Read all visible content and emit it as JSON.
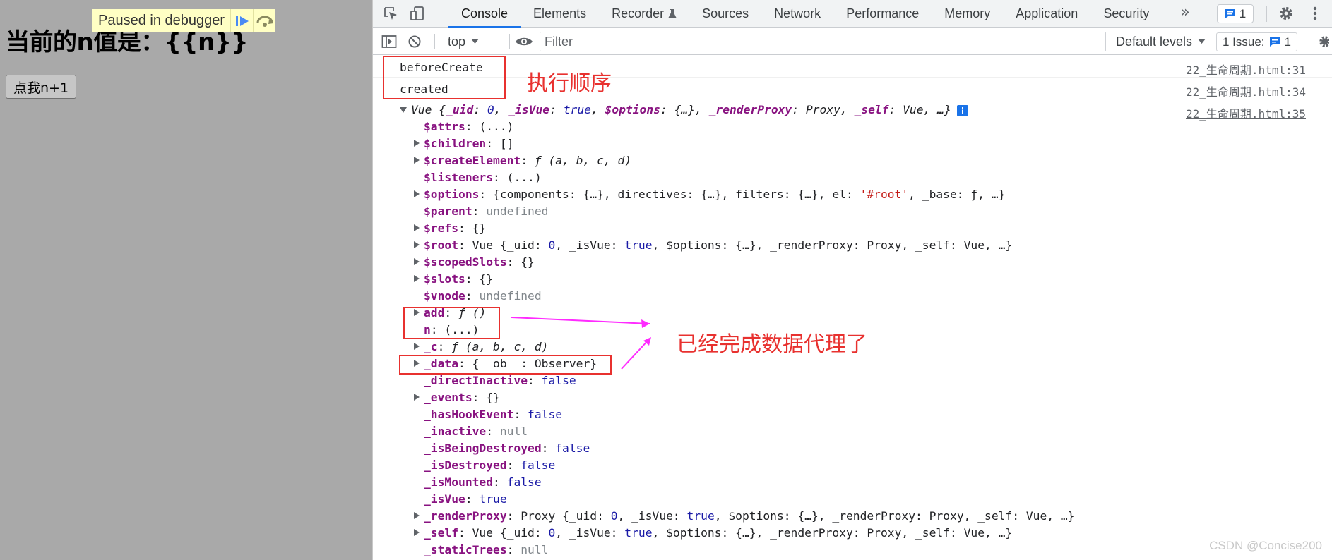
{
  "page": {
    "heading": "当前的n值是：{{n}}",
    "button_label": "点我n+1",
    "debugger_banner": "Paused in debugger",
    "colors": {
      "page_bg": "#a9a9a9",
      "banner_bg": "#ffffc4",
      "resume_icon": "#4a8af4",
      "step_icon": "#8a8a60"
    }
  },
  "devtools": {
    "tabs": [
      "Console",
      "Elements",
      "Recorder",
      "Sources",
      "Network",
      "Performance",
      "Memory",
      "Application",
      "Security"
    ],
    "active_tab": "Console",
    "more_tabs_glyph": "»",
    "messages_badge_count": "1",
    "toolbar": {
      "context": "top",
      "filter_placeholder": "Filter",
      "levels": "Default levels",
      "issues_label": "1 Issue:",
      "issues_count": "1"
    },
    "colors": {
      "accent": "#1a73e8",
      "key": "#881280",
      "keyword": "#1a1aa6",
      "string": "#c41a16",
      "muted": "#80868b"
    }
  },
  "console": {
    "messages": [
      {
        "text": "beforeCreate",
        "source": "22_生命周期.html:31"
      },
      {
        "text": "created",
        "source": "22_生命周期.html:34"
      }
    ],
    "object_source": "22_生命周期.html:35",
    "object_summary": {
      "name": "Vue",
      "parts": [
        [
          "p",
          " {"
        ],
        [
          "k",
          "_uid"
        ],
        [
          "p",
          ": "
        ],
        [
          "kw",
          "0"
        ],
        [
          "p",
          ", "
        ],
        [
          "k",
          "_isVue"
        ],
        [
          "p",
          ": "
        ],
        [
          "kw",
          "true"
        ],
        [
          "p",
          ", "
        ],
        [
          "k",
          "$options"
        ],
        [
          "p",
          ": {…}, "
        ],
        [
          "k",
          "_renderProxy"
        ],
        [
          "p",
          ": Proxy, "
        ],
        [
          "k",
          "_self"
        ],
        [
          "p",
          ": Vue, …}"
        ]
      ]
    },
    "props": [
      {
        "key": "$attrs",
        "expandable": false,
        "parts": [
          [
            "p",
            "(...)"
          ]
        ]
      },
      {
        "key": "$children",
        "expandable": true,
        "parts": [
          [
            "p",
            "[]"
          ]
        ]
      },
      {
        "key": "$createElement",
        "expandable": true,
        "parts": [
          [
            "p",
            "ƒ (a, b, c, d)"
          ]
        ],
        "italic": true
      },
      {
        "key": "$listeners",
        "expandable": false,
        "parts": [
          [
            "p",
            "(...)"
          ]
        ]
      },
      {
        "key": "$options",
        "expandable": true,
        "parts": [
          [
            "p",
            "{components: {…}, directives: {…}, filters: {…}, el: "
          ],
          [
            "str",
            "'#root'"
          ],
          [
            "p",
            ", _base: ƒ, …}"
          ]
        ]
      },
      {
        "key": "$parent",
        "expandable": false,
        "parts": [
          [
            "gr",
            "undefined"
          ]
        ]
      },
      {
        "key": "$refs",
        "expandable": true,
        "parts": [
          [
            "p",
            "{}"
          ]
        ]
      },
      {
        "key": "$root",
        "expandable": true,
        "parts": [
          [
            "p",
            "Vue {_uid: "
          ],
          [
            "kw",
            "0"
          ],
          [
            "p",
            ", _isVue: "
          ],
          [
            "kw",
            "true"
          ],
          [
            "p",
            ", $options: {…}, _renderProxy: Proxy, _self: Vue, …}"
          ]
        ]
      },
      {
        "key": "$scopedSlots",
        "expandable": true,
        "parts": [
          [
            "p",
            "{}"
          ]
        ]
      },
      {
        "key": "$slots",
        "expandable": true,
        "parts": [
          [
            "p",
            "{}"
          ]
        ]
      },
      {
        "key": "$vnode",
        "expandable": false,
        "parts": [
          [
            "gr",
            "undefined"
          ]
        ]
      },
      {
        "key": "add",
        "expandable": true,
        "parts": [
          [
            "p",
            "ƒ ()"
          ]
        ],
        "italic": true
      },
      {
        "key": "n",
        "expandable": false,
        "parts": [
          [
            "p",
            "(...)"
          ]
        ]
      },
      {
        "key": "_c",
        "expandable": true,
        "parts": [
          [
            "p",
            "ƒ (a, b, c, d)"
          ]
        ],
        "italic": true
      },
      {
        "key": "_data",
        "expandable": true,
        "parts": [
          [
            "p",
            "{__ob__: Observer}"
          ]
        ]
      },
      {
        "key": "_directInactive",
        "expandable": false,
        "parts": [
          [
            "kw",
            "false"
          ]
        ]
      },
      {
        "key": "_events",
        "expandable": true,
        "parts": [
          [
            "p",
            "{}"
          ]
        ]
      },
      {
        "key": "_hasHookEvent",
        "expandable": false,
        "parts": [
          [
            "kw",
            "false"
          ]
        ]
      },
      {
        "key": "_inactive",
        "expandable": false,
        "parts": [
          [
            "gr",
            "null"
          ]
        ]
      },
      {
        "key": "_isBeingDestroyed",
        "expandable": false,
        "parts": [
          [
            "kw",
            "false"
          ]
        ]
      },
      {
        "key": "_isDestroyed",
        "expandable": false,
        "parts": [
          [
            "kw",
            "false"
          ]
        ]
      },
      {
        "key": "_isMounted",
        "expandable": false,
        "parts": [
          [
            "kw",
            "false"
          ]
        ]
      },
      {
        "key": "_isVue",
        "expandable": false,
        "parts": [
          [
            "kw",
            "true"
          ]
        ]
      },
      {
        "key": "_renderProxy",
        "expandable": true,
        "parts": [
          [
            "p",
            "Proxy {_uid: "
          ],
          [
            "kw",
            "0"
          ],
          [
            "p",
            ", _isVue: "
          ],
          [
            "kw",
            "true"
          ],
          [
            "p",
            ", $options: {…}, _renderProxy: Proxy, _self: Vue, …}"
          ]
        ]
      },
      {
        "key": "_self",
        "expandable": true,
        "parts": [
          [
            "p",
            "Vue {_uid: "
          ],
          [
            "kw",
            "0"
          ],
          [
            "p",
            ", _isVue: "
          ],
          [
            "kw",
            "true"
          ],
          [
            "p",
            ", $options: {…}, _renderProxy: Proxy, _self: Vue, …}"
          ]
        ]
      },
      {
        "key": "_staticTrees",
        "expandable": false,
        "parts": [
          [
            "gr",
            "null"
          ]
        ]
      }
    ]
  },
  "annotations": {
    "order_label": "执行顺序",
    "proxy_label": "已经完成数据代理了",
    "color": "#e8312f",
    "arrow_color": "#ff2bff"
  },
  "watermark": "CSDN @Concise200"
}
